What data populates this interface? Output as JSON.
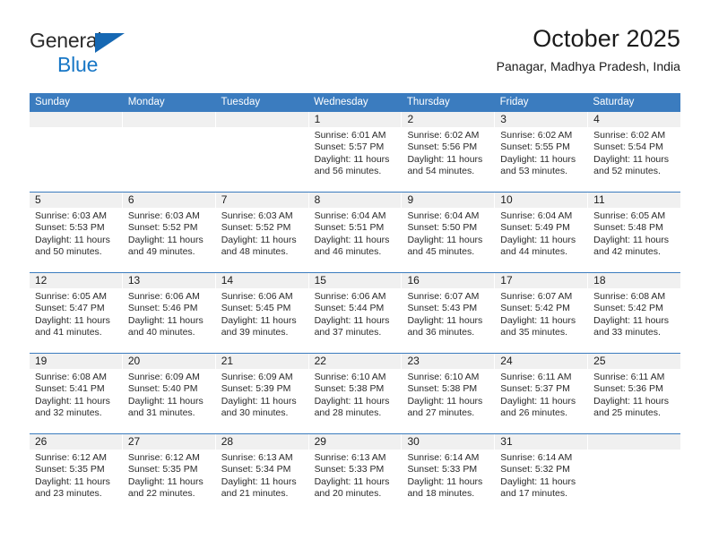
{
  "brand": {
    "name_top": "General",
    "name_bottom": "Blue",
    "triangle_color": "#1668b3",
    "bottom_color": "#1877c6"
  },
  "header": {
    "month_title": "October 2025",
    "location": "Panagar, Madhya Pradesh, India"
  },
  "calendar": {
    "header_color": "#3b7cbf",
    "day_number_band_color": "#f0f0f0",
    "weekdays": [
      "Sunday",
      "Monday",
      "Tuesday",
      "Wednesday",
      "Thursday",
      "Friday",
      "Saturday"
    ],
    "weeks": [
      [
        {
          "empty": true
        },
        {
          "empty": true
        },
        {
          "empty": true
        },
        {
          "day": "1",
          "sunrise": "Sunrise: 6:01 AM",
          "sunset": "Sunset: 5:57 PM",
          "daylight_line1": "Daylight: 11 hours",
          "daylight_line2": "and 56 minutes."
        },
        {
          "day": "2",
          "sunrise": "Sunrise: 6:02 AM",
          "sunset": "Sunset: 5:56 PM",
          "daylight_line1": "Daylight: 11 hours",
          "daylight_line2": "and 54 minutes."
        },
        {
          "day": "3",
          "sunrise": "Sunrise: 6:02 AM",
          "sunset": "Sunset: 5:55 PM",
          "daylight_line1": "Daylight: 11 hours",
          "daylight_line2": "and 53 minutes."
        },
        {
          "day": "4",
          "sunrise": "Sunrise: 6:02 AM",
          "sunset": "Sunset: 5:54 PM",
          "daylight_line1": "Daylight: 11 hours",
          "daylight_line2": "and 52 minutes."
        }
      ],
      [
        {
          "day": "5",
          "sunrise": "Sunrise: 6:03 AM",
          "sunset": "Sunset: 5:53 PM",
          "daylight_line1": "Daylight: 11 hours",
          "daylight_line2": "and 50 minutes."
        },
        {
          "day": "6",
          "sunrise": "Sunrise: 6:03 AM",
          "sunset": "Sunset: 5:52 PM",
          "daylight_line1": "Daylight: 11 hours",
          "daylight_line2": "and 49 minutes."
        },
        {
          "day": "7",
          "sunrise": "Sunrise: 6:03 AM",
          "sunset": "Sunset: 5:52 PM",
          "daylight_line1": "Daylight: 11 hours",
          "daylight_line2": "and 48 minutes."
        },
        {
          "day": "8",
          "sunrise": "Sunrise: 6:04 AM",
          "sunset": "Sunset: 5:51 PM",
          "daylight_line1": "Daylight: 11 hours",
          "daylight_line2": "and 46 minutes."
        },
        {
          "day": "9",
          "sunrise": "Sunrise: 6:04 AM",
          "sunset": "Sunset: 5:50 PM",
          "daylight_line1": "Daylight: 11 hours",
          "daylight_line2": "and 45 minutes."
        },
        {
          "day": "10",
          "sunrise": "Sunrise: 6:04 AM",
          "sunset": "Sunset: 5:49 PM",
          "daylight_line1": "Daylight: 11 hours",
          "daylight_line2": "and 44 minutes."
        },
        {
          "day": "11",
          "sunrise": "Sunrise: 6:05 AM",
          "sunset": "Sunset: 5:48 PM",
          "daylight_line1": "Daylight: 11 hours",
          "daylight_line2": "and 42 minutes."
        }
      ],
      [
        {
          "day": "12",
          "sunrise": "Sunrise: 6:05 AM",
          "sunset": "Sunset: 5:47 PM",
          "daylight_line1": "Daylight: 11 hours",
          "daylight_line2": "and 41 minutes."
        },
        {
          "day": "13",
          "sunrise": "Sunrise: 6:06 AM",
          "sunset": "Sunset: 5:46 PM",
          "daylight_line1": "Daylight: 11 hours",
          "daylight_line2": "and 40 minutes."
        },
        {
          "day": "14",
          "sunrise": "Sunrise: 6:06 AM",
          "sunset": "Sunset: 5:45 PM",
          "daylight_line1": "Daylight: 11 hours",
          "daylight_line2": "and 39 minutes."
        },
        {
          "day": "15",
          "sunrise": "Sunrise: 6:06 AM",
          "sunset": "Sunset: 5:44 PM",
          "daylight_line1": "Daylight: 11 hours",
          "daylight_line2": "and 37 minutes."
        },
        {
          "day": "16",
          "sunrise": "Sunrise: 6:07 AM",
          "sunset": "Sunset: 5:43 PM",
          "daylight_line1": "Daylight: 11 hours",
          "daylight_line2": "and 36 minutes."
        },
        {
          "day": "17",
          "sunrise": "Sunrise: 6:07 AM",
          "sunset": "Sunset: 5:42 PM",
          "daylight_line1": "Daylight: 11 hours",
          "daylight_line2": "and 35 minutes."
        },
        {
          "day": "18",
          "sunrise": "Sunrise: 6:08 AM",
          "sunset": "Sunset: 5:42 PM",
          "daylight_line1": "Daylight: 11 hours",
          "daylight_line2": "and 33 minutes."
        }
      ],
      [
        {
          "day": "19",
          "sunrise": "Sunrise: 6:08 AM",
          "sunset": "Sunset: 5:41 PM",
          "daylight_line1": "Daylight: 11 hours",
          "daylight_line2": "and 32 minutes."
        },
        {
          "day": "20",
          "sunrise": "Sunrise: 6:09 AM",
          "sunset": "Sunset: 5:40 PM",
          "daylight_line1": "Daylight: 11 hours",
          "daylight_line2": "and 31 minutes."
        },
        {
          "day": "21",
          "sunrise": "Sunrise: 6:09 AM",
          "sunset": "Sunset: 5:39 PM",
          "daylight_line1": "Daylight: 11 hours",
          "daylight_line2": "and 30 minutes."
        },
        {
          "day": "22",
          "sunrise": "Sunrise: 6:10 AM",
          "sunset": "Sunset: 5:38 PM",
          "daylight_line1": "Daylight: 11 hours",
          "daylight_line2": "and 28 minutes."
        },
        {
          "day": "23",
          "sunrise": "Sunrise: 6:10 AM",
          "sunset": "Sunset: 5:38 PM",
          "daylight_line1": "Daylight: 11 hours",
          "daylight_line2": "and 27 minutes."
        },
        {
          "day": "24",
          "sunrise": "Sunrise: 6:11 AM",
          "sunset": "Sunset: 5:37 PM",
          "daylight_line1": "Daylight: 11 hours",
          "daylight_line2": "and 26 minutes."
        },
        {
          "day": "25",
          "sunrise": "Sunrise: 6:11 AM",
          "sunset": "Sunset: 5:36 PM",
          "daylight_line1": "Daylight: 11 hours",
          "daylight_line2": "and 25 minutes."
        }
      ],
      [
        {
          "day": "26",
          "sunrise": "Sunrise: 6:12 AM",
          "sunset": "Sunset: 5:35 PM",
          "daylight_line1": "Daylight: 11 hours",
          "daylight_line2": "and 23 minutes."
        },
        {
          "day": "27",
          "sunrise": "Sunrise: 6:12 AM",
          "sunset": "Sunset: 5:35 PM",
          "daylight_line1": "Daylight: 11 hours",
          "daylight_line2": "and 22 minutes."
        },
        {
          "day": "28",
          "sunrise": "Sunrise: 6:13 AM",
          "sunset": "Sunset: 5:34 PM",
          "daylight_line1": "Daylight: 11 hours",
          "daylight_line2": "and 21 minutes."
        },
        {
          "day": "29",
          "sunrise": "Sunrise: 6:13 AM",
          "sunset": "Sunset: 5:33 PM",
          "daylight_line1": "Daylight: 11 hours",
          "daylight_line2": "and 20 minutes."
        },
        {
          "day": "30",
          "sunrise": "Sunrise: 6:14 AM",
          "sunset": "Sunset: 5:33 PM",
          "daylight_line1": "Daylight: 11 hours",
          "daylight_line2": "and 18 minutes."
        },
        {
          "day": "31",
          "sunrise": "Sunrise: 6:14 AM",
          "sunset": "Sunset: 5:32 PM",
          "daylight_line1": "Daylight: 11 hours",
          "daylight_line2": "and 17 minutes."
        },
        {
          "empty": true
        }
      ]
    ]
  }
}
